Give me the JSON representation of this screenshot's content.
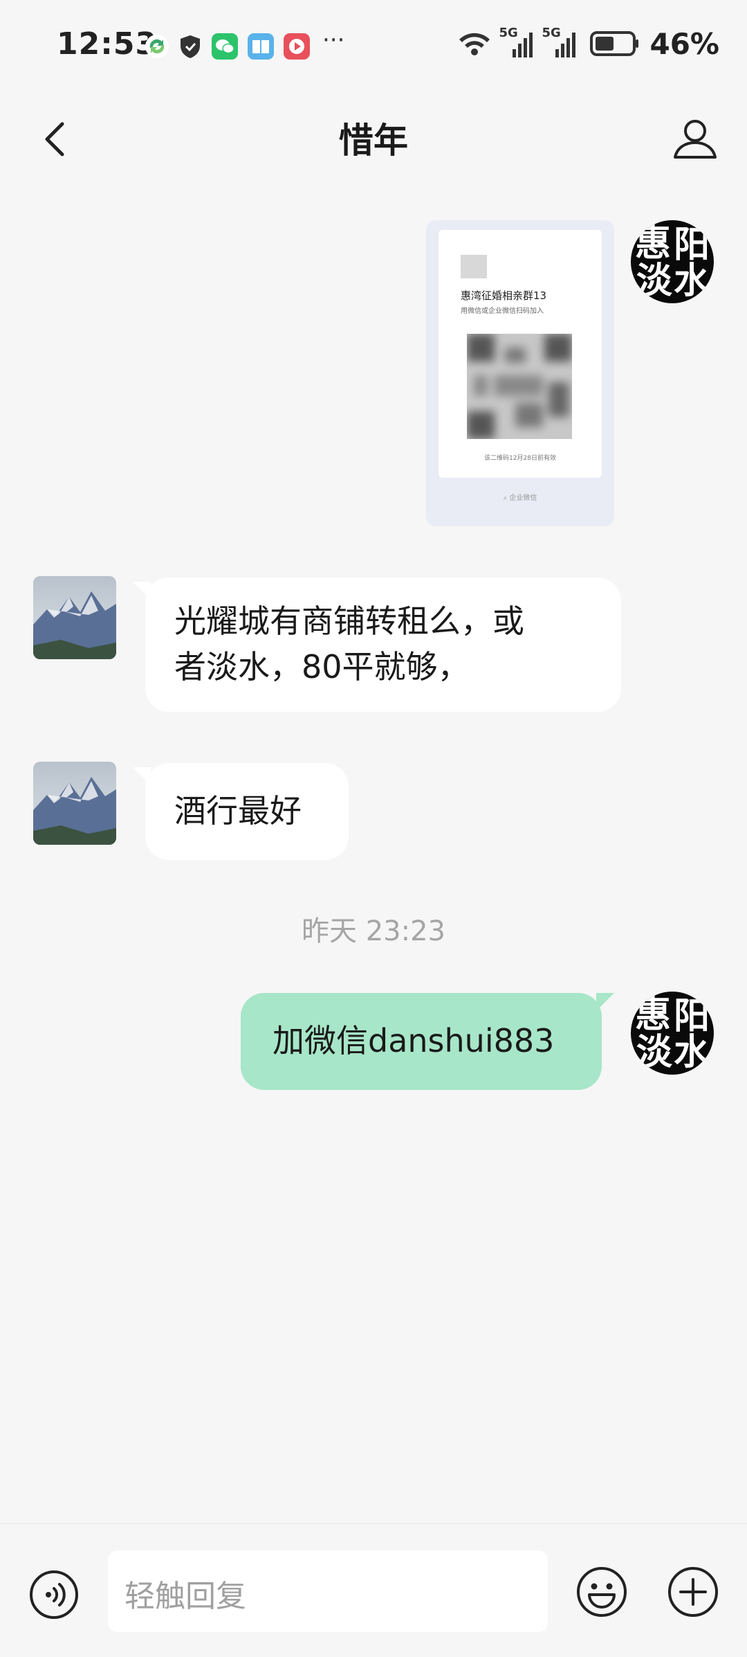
{
  "status_bar": {
    "time": "12:53",
    "network_1": "5G",
    "network_2": "5G",
    "battery": "46%",
    "notification_icons": [
      "sync-app-icon",
      "shield-icon",
      "wechat-icon",
      "reader-icon",
      "video-icon"
    ],
    "more": "···"
  },
  "nav": {
    "title": "惜年"
  },
  "messages": [
    {
      "side": "out",
      "type": "card",
      "card": {
        "title": "惠湾征婚相亲群13",
        "subtitle": "用微信或企业微信扫码加入",
        "valid": "该二维码12月28日前有效",
        "footer": "企业微信"
      }
    },
    {
      "side": "in",
      "type": "text",
      "lines": [
        "光耀城有商铺转租么，或",
        "者淡水，80平就够，"
      ]
    },
    {
      "side": "in",
      "type": "text",
      "text": "酒行最好"
    },
    {
      "type": "timestamp",
      "text": "昨天 23:23"
    },
    {
      "side": "out",
      "type": "text",
      "text": "加微信danshui883"
    }
  ],
  "my_avatar_text": [
    "惠",
    "阳",
    "淡",
    "水"
  ],
  "input": {
    "placeholder": "轻触回复"
  },
  "colors": {
    "background": "#f5f6f5",
    "outgoing_bubble": "#a7e6c8",
    "incoming_bubble": "#ffffff",
    "timestamp": "#a5a5a5"
  }
}
